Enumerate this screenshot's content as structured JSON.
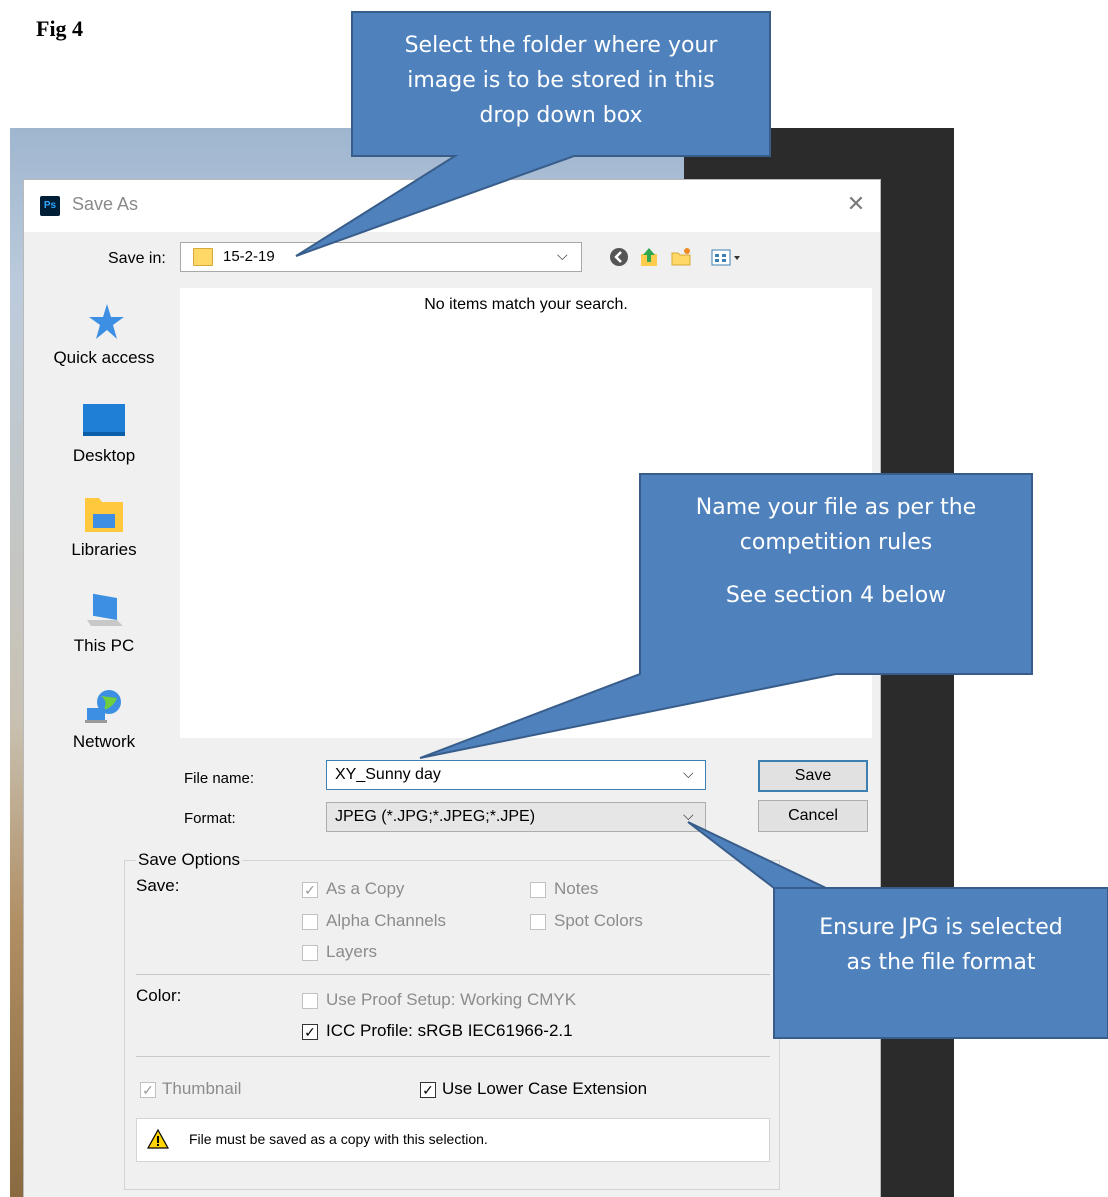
{
  "figure_label": "Fig 4",
  "dialog": {
    "app_icon": "Ps",
    "title": "Save As",
    "close_icon": "close-icon",
    "save_in_label": "Save in:",
    "save_in_value": "15-2-19",
    "empty_message": "No items match your search.",
    "places": [
      "Quick access",
      "Desktop",
      "Libraries",
      "This PC",
      "Network"
    ],
    "file_name_label": "File name:",
    "file_name_value": "XY_Sunny day",
    "format_label": "Format:",
    "format_value": "JPEG (*.JPG;*.JPEG;*.JPE)",
    "save_button": "Save",
    "cancel_button": "Cancel",
    "save_options": {
      "title": "Save Options",
      "save_label": "Save:",
      "as_a_copy": "As a Copy",
      "notes": "Notes",
      "alpha_channels": "Alpha Channels",
      "spot_colors": "Spot Colors",
      "layers": "Layers",
      "color_label": "Color:",
      "use_proof_setup": "Use Proof Setup:  Working CMYK",
      "icc_profile": "ICC Profile:  sRGB IEC61966-2.1",
      "thumbnail": "Thumbnail",
      "lower_case_ext": "Use Lower Case Extension",
      "warning": "File must be saved as a copy with this selection."
    }
  },
  "callouts": {
    "folder": [
      "Select the folder where your",
      "image is to be stored in this",
      "drop down box"
    ],
    "name": [
      "Name your file as per the",
      "competition rules",
      "See section 4 below"
    ],
    "format": [
      "Ensure JPG is selected",
      "as the file format"
    ]
  },
  "colors": {
    "callout_fill": "#4f81bd",
    "callout_border": "#385d8a",
    "dialog_bg": "#f0f0f0",
    "focus_blue": "#3c7fb1"
  }
}
